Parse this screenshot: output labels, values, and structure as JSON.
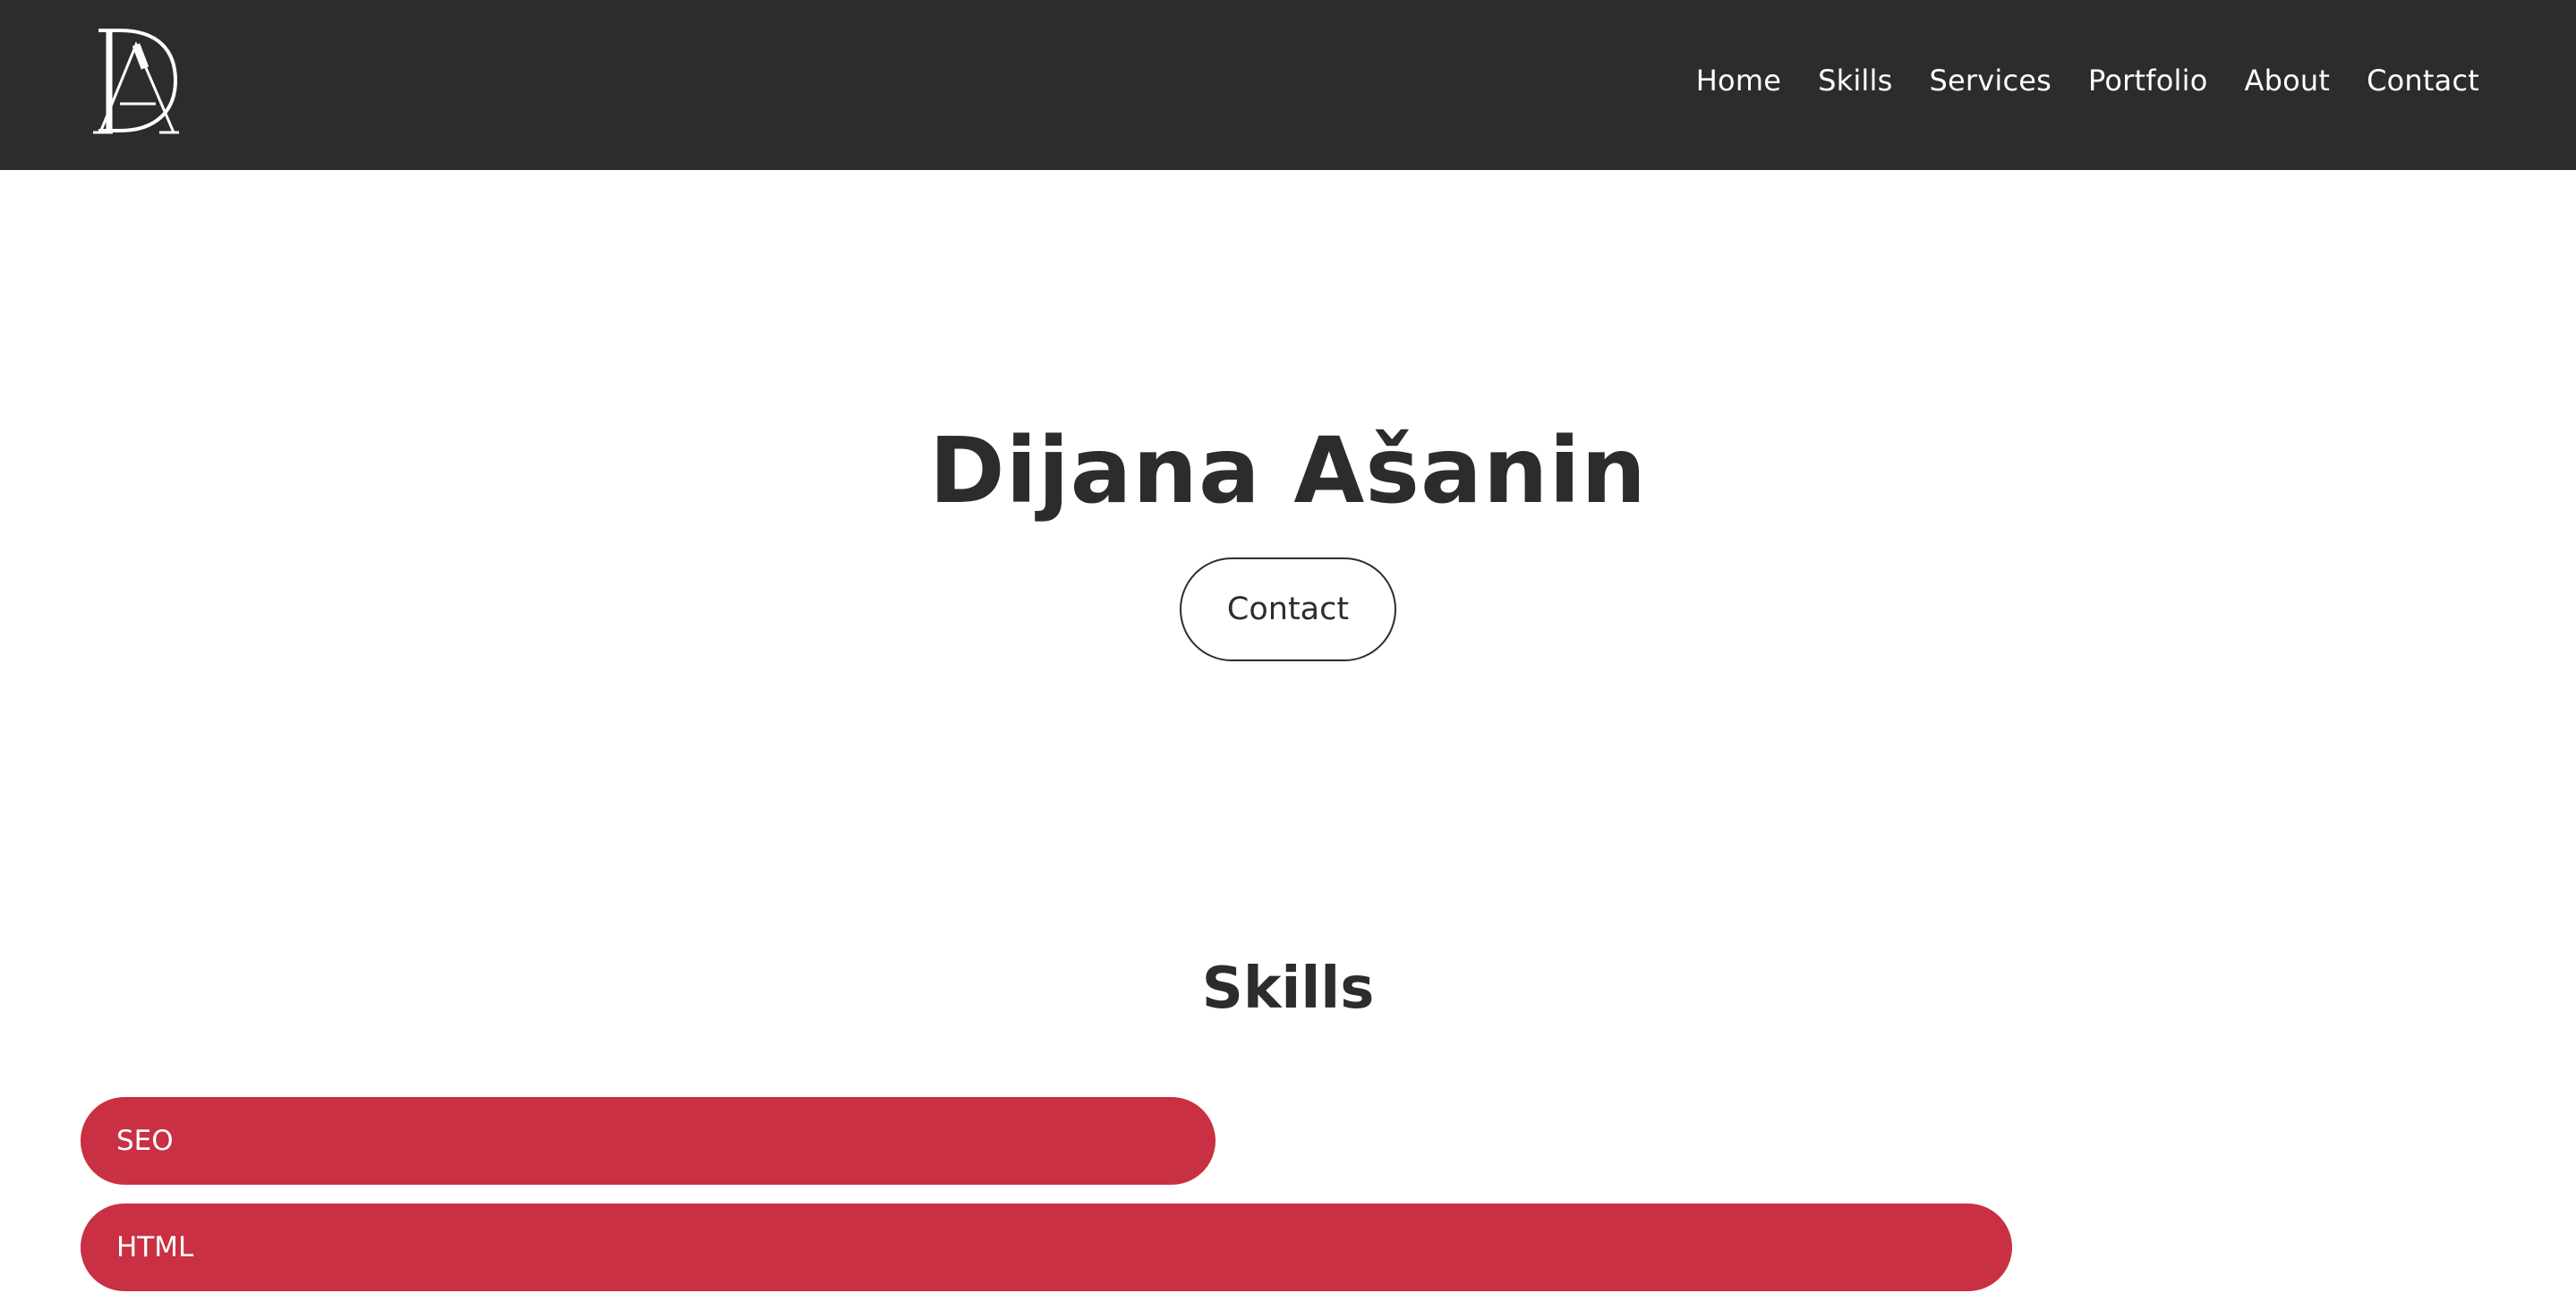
{
  "header": {
    "logo_text": "DA",
    "nav": [
      {
        "label": "Home"
      },
      {
        "label": "Skills"
      },
      {
        "label": "Services"
      },
      {
        "label": "Portfolio"
      },
      {
        "label": "About"
      },
      {
        "label": "Contact"
      }
    ]
  },
  "hero": {
    "name": "Dijana Ašanin",
    "contact_button": "Contact"
  },
  "skills": {
    "title": "Skills",
    "items": [
      {
        "label": "SEO",
        "level_percent": 47
      },
      {
        "label": "HTML",
        "level_percent": 80
      }
    ]
  },
  "colors": {
    "navbar_bg": "#2c2c2c",
    "text_dark": "#2c2c2c",
    "skill_bar": "#c93043",
    "page_bg": "#ffffff"
  }
}
